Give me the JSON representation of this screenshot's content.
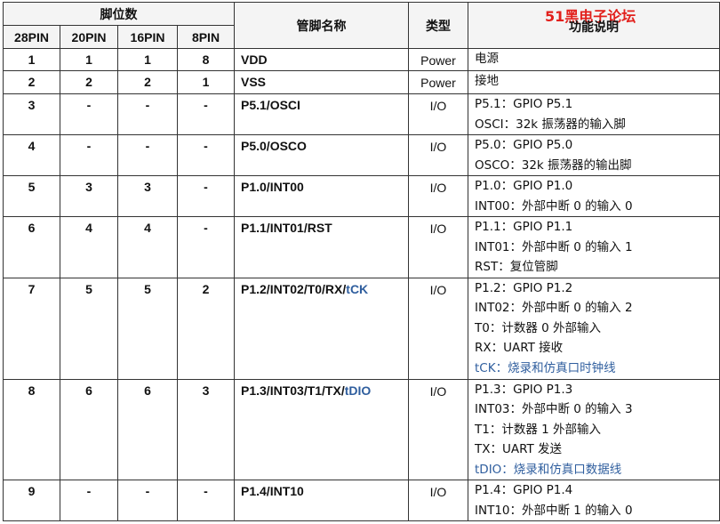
{
  "header": {
    "pin_group": "脚位数",
    "pin_cols": [
      "28PIN",
      "20PIN",
      "16PIN",
      "8PIN"
    ],
    "name": "管脚名称",
    "type": "类型",
    "func": "功能说明",
    "watermark": "51黑电子论坛"
  },
  "rows": [
    {
      "p28": "1",
      "p20": "1",
      "p16": "1",
      "p8": "8",
      "name": "VDD",
      "name_blue": "",
      "type": "Power",
      "func": [
        {
          "t": "电源",
          "blue": false
        }
      ]
    },
    {
      "p28": "2",
      "p20": "2",
      "p16": "2",
      "p8": "1",
      "name": "VSS",
      "name_blue": "",
      "type": "Power",
      "func": [
        {
          "t": "接地",
          "blue": false
        }
      ]
    },
    {
      "p28": "3",
      "p20": "-",
      "p16": "-",
      "p8": "-",
      "name": "P5.1/OSCI",
      "name_blue": "",
      "type": "I/O",
      "func": [
        {
          "t": "P5.1：GPIO P5.1",
          "blue": false
        },
        {
          "t": "OSCI：32k 振荡器的输入脚",
          "blue": false
        }
      ]
    },
    {
      "p28": "4",
      "p20": "-",
      "p16": "-",
      "p8": "-",
      "name": "P5.0/OSCO",
      "name_blue": "",
      "type": "I/O",
      "func": [
        {
          "t": "P5.0：GPIO P5.0",
          "blue": false
        },
        {
          "t": "OSCO：32k 振荡器的输出脚",
          "blue": false
        }
      ]
    },
    {
      "p28": "5",
      "p20": "3",
      "p16": "3",
      "p8": "-",
      "name": "P1.0/INT00",
      "name_blue": "",
      "type": "I/O",
      "func": [
        {
          "t": "P1.0：GPIO P1.0",
          "blue": false
        },
        {
          "t": "INT00：外部中断 0 的输入 0",
          "blue": false
        }
      ]
    },
    {
      "p28": "6",
      "p20": "4",
      "p16": "4",
      "p8": "-",
      "name": "P1.1/INT01/RST",
      "name_blue": "",
      "type": "I/O",
      "func": [
        {
          "t": "P1.1：GPIO P1.1",
          "blue": false
        },
        {
          "t": "INT01：外部中断 0 的输入 1",
          "blue": false
        },
        {
          "t": "RST：复位管脚",
          "blue": false
        }
      ]
    },
    {
      "p28": "7",
      "p20": "5",
      "p16": "5",
      "p8": "2",
      "name": "P1.2/INT02/T0/RX/",
      "name_blue": "tCK",
      "type": "I/O",
      "func": [
        {
          "t": "P1.2：GPIO P1.2",
          "blue": false
        },
        {
          "t": "INT02：外部中断 0 的输入 2",
          "blue": false
        },
        {
          "t": "T0：计数器 0 外部输入",
          "blue": false
        },
        {
          "t": "RX：UART 接收",
          "blue": false
        },
        {
          "t": "tCK：烧录和仿真口时钟线",
          "blue": true
        }
      ]
    },
    {
      "p28": "8",
      "p20": "6",
      "p16": "6",
      "p8": "3",
      "name": "P1.3/INT03/T1/TX/",
      "name_blue": "tDIO",
      "type": "I/O",
      "func": [
        {
          "t": "P1.3：GPIO P1.3",
          "blue": false
        },
        {
          "t": "INT03：外部中断 0 的输入 3",
          "blue": false
        },
        {
          "t": "T1：计数器 1 外部输入",
          "blue": false
        },
        {
          "t": "TX：UART 发送",
          "blue": false
        },
        {
          "t": "tDIO：烧录和仿真口数据线",
          "blue": true
        }
      ]
    },
    {
      "p28": "9",
      "p20": "-",
      "p16": "-",
      "p8": "-",
      "name": "P1.4/INT10",
      "name_blue": "",
      "type": "I/O",
      "func": [
        {
          "t": "P1.4：GPIO P1.4",
          "blue": false
        },
        {
          "t": "INT10：外部中断 1 的输入 0",
          "blue": false
        }
      ]
    }
  ]
}
